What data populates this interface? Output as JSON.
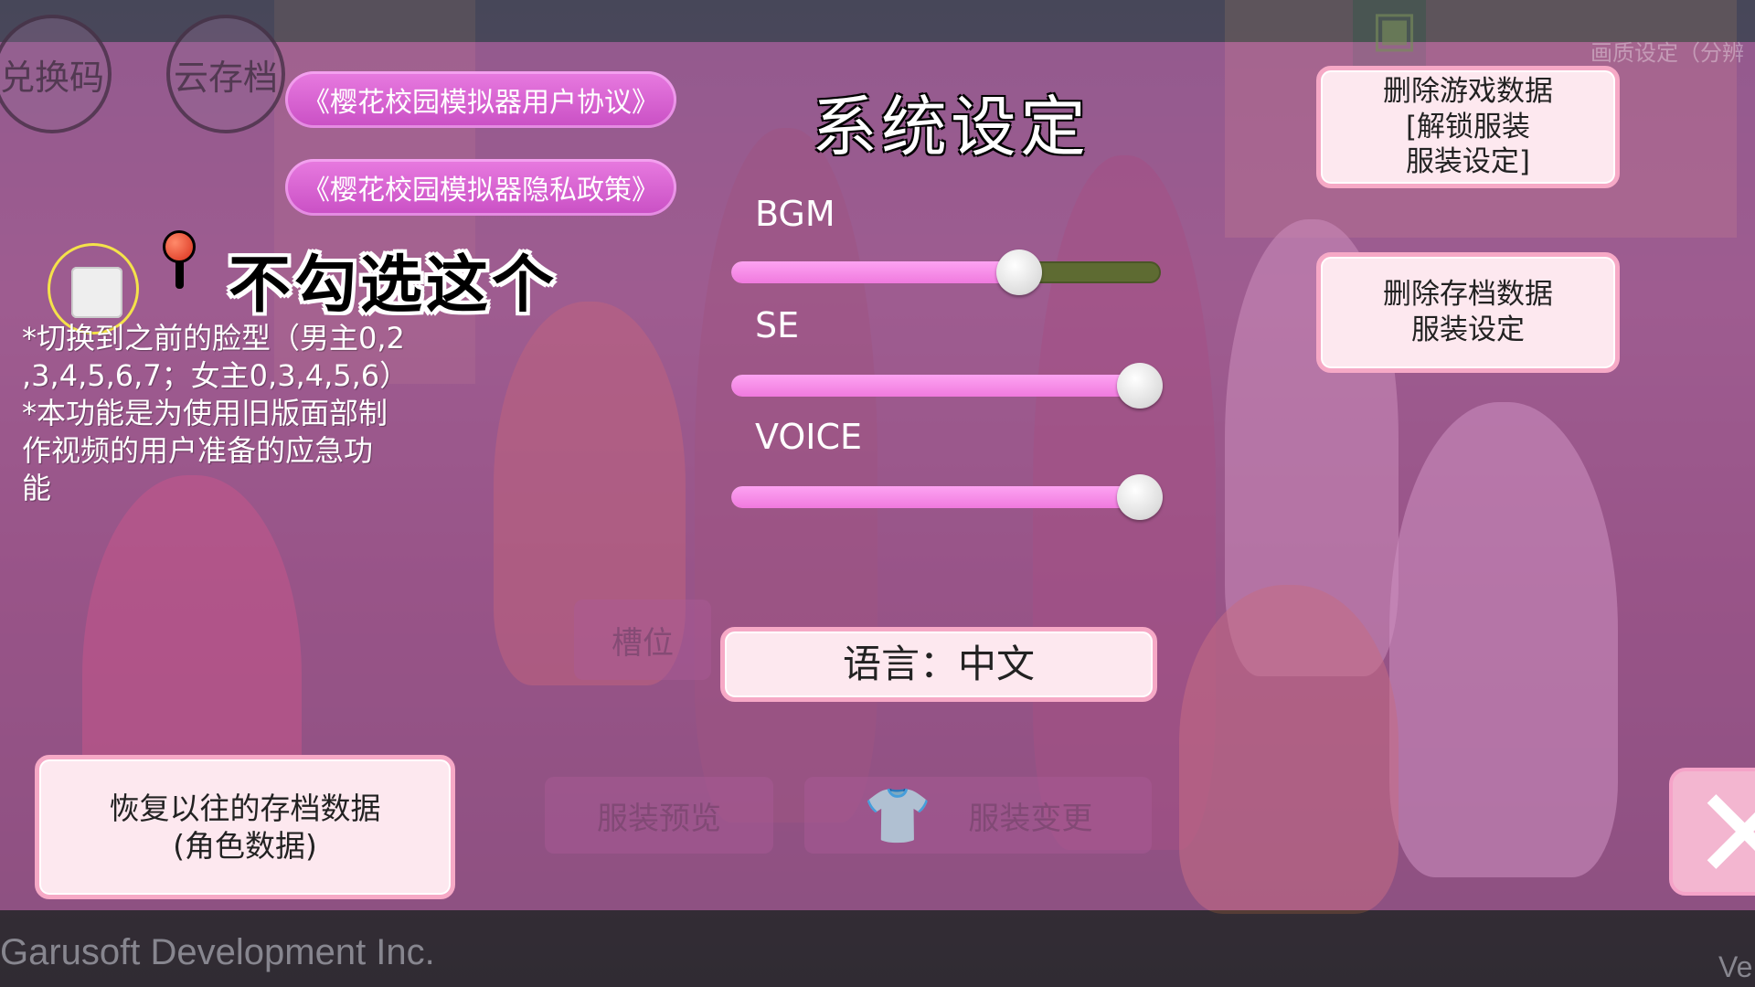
{
  "header": {
    "title": "系统设定",
    "redeem_code": "兑换码",
    "cloud_save": "云存档",
    "graphics_setting": "画质设定（分辨"
  },
  "links": {
    "user_agreement": "《樱花校园模拟器用户协议》",
    "privacy_policy": "《樱花校园模拟器隐私政策》"
  },
  "legacy_face": {
    "annotation": "不勾选这个",
    "note": "*切换到之前的脸型（男主0,2\n,3,4,5,6,7；女主0,3,4,5,6）\n*本功能是为使用旧版面部制\n作视频的用户准备的应急功\n能",
    "checked": false
  },
  "audio": {
    "bgm_label": "BGM",
    "bgm_level": 0.67,
    "se_label": "SE",
    "se_level": 0.95,
    "voice_label": "VOICE",
    "voice_level": 0.95
  },
  "language_button": "语言：中文",
  "right_buttons": {
    "delete_game_data": [
      "删除游戏数据",
      "[解锁服装",
      "服装设定]"
    ],
    "delete_save_data": [
      "删除存档数据",
      "服装设定"
    ]
  },
  "restore_button": [
    "恢复以往的存档数据",
    "(角色数据)"
  ],
  "background_ghost": {
    "slot": "槽位",
    "costume_preview": "服装预览",
    "costume_change": "服装变更"
  },
  "footer": {
    "company": "Garusoft Development Inc.",
    "version_prefix": "Ve"
  },
  "colors": {
    "overlay": "#be64af",
    "pill": "#d95fd2",
    "slider_fill": "#f48ae4",
    "slider_track": "#5e6b32",
    "button_face": "#fde8ef",
    "button_border": "#f6a9c6"
  }
}
